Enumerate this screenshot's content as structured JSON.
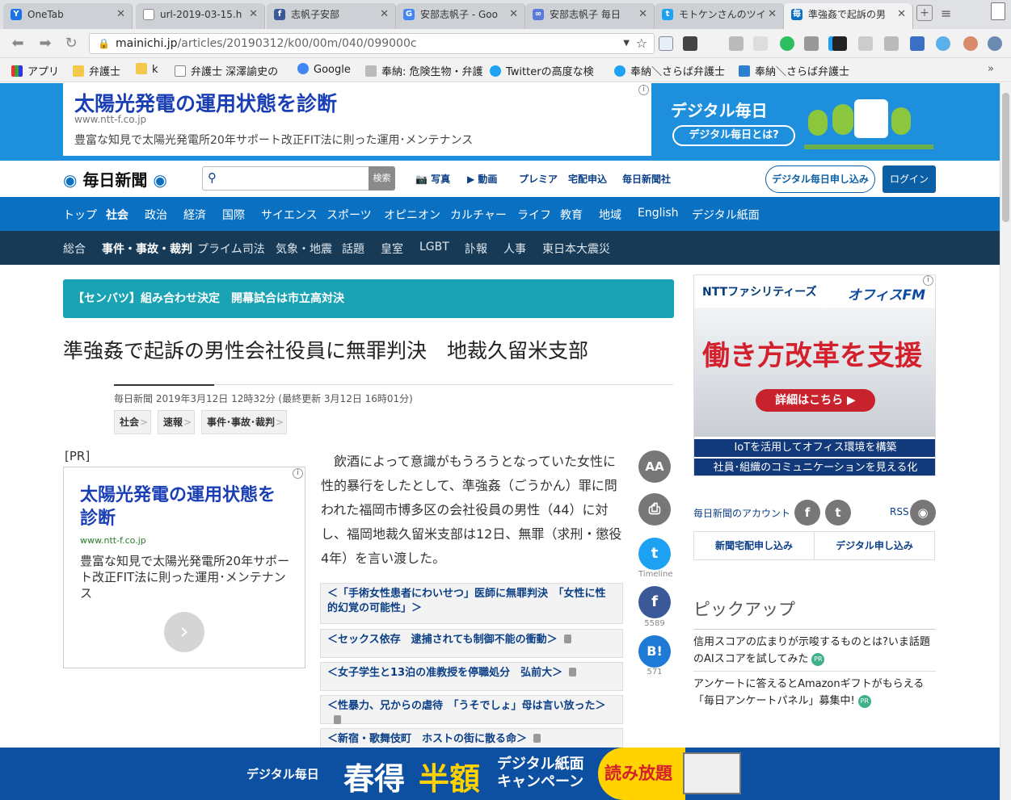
{
  "browser": {
    "tabs": [
      {
        "title": "OneTab",
        "icon": "onetab-icon",
        "color": "#1a73e8"
      },
      {
        "title": "url-2019-03-15.h",
        "icon": "document-icon",
        "color": "#888888"
      },
      {
        "title": "志帆子安部",
        "icon": "facebook-icon",
        "color": "#3b5998"
      },
      {
        "title": "安部志帆子 - Goo",
        "icon": "google-icon",
        "color": "#4285f4"
      },
      {
        "title": "安部志帆子 毎日",
        "icon": "link-icon",
        "color": "#5a7bd8"
      },
      {
        "title": "モトケンさんのツイ",
        "icon": "twitter-icon",
        "color": "#1da1f2"
      },
      {
        "title": "準強姦で起訴の男",
        "icon": "mainichi-icon",
        "color": "#0a70c2"
      }
    ],
    "url_host": "mainichi.jp",
    "url_path": "/articles/20190312/k00/00m/040/099000c",
    "bookmarks": [
      {
        "label": "アプリ",
        "icon": "apps-grid-icon"
      },
      {
        "label": "弁護士",
        "icon": "folder-icon"
      },
      {
        "label": "k",
        "icon": "folder-icon"
      },
      {
        "label": "弁護士 深澤諭史の",
        "icon": "document-icon"
      },
      {
        "label": "Google",
        "icon": "google-icon"
      },
      {
        "label": "奉納: 危険生物・弁護",
        "icon": "hazard-icon"
      },
      {
        "label": "Twitterの高度な検",
        "icon": "twitter-icon"
      },
      {
        "label": "奉納＼さらば弁護士",
        "icon": "twitter-icon"
      },
      {
        "label": "奉納＼さらば弁護士",
        "icon": "blog-icon"
      }
    ]
  },
  "top_ad": {
    "title": "太陽光発電の運用状態を診断",
    "url": "www.ntt-f.co.jp",
    "desc": "豊富な知見で太陽光発電所20年サポート改正FIT法に則った運用･メンテナンス",
    "digital_logo": "デジタル毎日",
    "digital_button": "デジタル毎日とは?"
  },
  "header": {
    "logo": "毎日新聞",
    "search_button": "検索",
    "links": [
      "写真",
      "動画",
      "プレミア",
      "宅配申込",
      "毎日新聞社"
    ],
    "apply_button": "デジタル毎日申し込み",
    "login_button": "ログイン"
  },
  "nav_primary": [
    "トップ",
    "社会",
    "政治",
    "経済",
    "国際",
    "サイエンス",
    "スポーツ",
    "オピニオン",
    "カルチャー",
    "ライフ",
    "教育",
    "地域",
    "English",
    "デジタル紙面"
  ],
  "nav_secondary": [
    "総合",
    "事件・事故・裁判",
    "プライム司法",
    "気象・地震",
    "話題",
    "皇室",
    "LGBT",
    "訃報",
    "人事",
    "東日本大震災"
  ],
  "banner": "【センバツ】組み合わせ決定　開幕試合は市立高対決",
  "article": {
    "headline": "準強姦で起訴の男性会社役員に無罪判決　地裁久留米支部",
    "dateline": "毎日新聞 2019年3月12日 12時32分 (最終更新 3月12日 16時01分)",
    "tags": [
      "社会",
      "速報",
      "事件･事故･裁判"
    ],
    "body": "飲酒によって意識がもうろうとなっていた女性に性的暴行をしたとして、準強姦（ごうかん）罪に問われた福岡市博多区の会社役員の男性（44）に対し、福岡地裁久留米支部は12日、無罪（求刑・懲役4年）を言い渡した。",
    "related": [
      "＜「手術女性患者にわいせつ」医師に無罪判決　「女性に性的幻覚の可能性」＞",
      "＜セックス依存　逮捕されても制御不能の衝動＞",
      "＜女子学生と13泊の准教授を停職処分　弘前大＞",
      "＜性暴力、兄からの虐待　「うそでしょ」母は言い放った＞",
      "＜新宿・歌舞伎町　ホストの街に散る命＞"
    ]
  },
  "pr_ad": {
    "label": "[PR]",
    "title": "太陽光発電の運用状態を診断",
    "url": "www.ntt-f.co.jp",
    "desc": "豊富な知見で太陽光発電所20年サポート改正FIT法に則った運用･メンテナンス"
  },
  "share": {
    "font": "AA",
    "twitter_label": "Timeline",
    "facebook_count": "5589",
    "hatena_count": "571",
    "hatena": "B!"
  },
  "right_ad": {
    "logo": "NTTファシリティーズ",
    "brand": "オフィスFM",
    "headline": "働き方改革を支援",
    "cta": "詳細はこちら ▶",
    "line1": "IoTを活用してオフィス環境を構築",
    "line2": "社員･組織のコミュニケーションを見える化"
  },
  "sidebar": {
    "account_label": "毎日新聞のアカウント",
    "rss_label": "RSS",
    "button1": "新聞宅配申し込み",
    "button2": "デジタル申し込み",
    "pickup_title": "ピックアップ",
    "pickups": [
      "信用スコアの広まりが示唆するものとは?いま話題のAIスコアを試してみた",
      "アンケートに答えるとAmazonギフトがもらえる「毎日アンケートパネル」募集中!"
    ]
  },
  "bottom_ad": {
    "logo": "デジタル毎日",
    "main1": "春得",
    "main2": "半額",
    "sub": "デジタル紙面キャンペーン",
    "yomi": "読み放題"
  }
}
